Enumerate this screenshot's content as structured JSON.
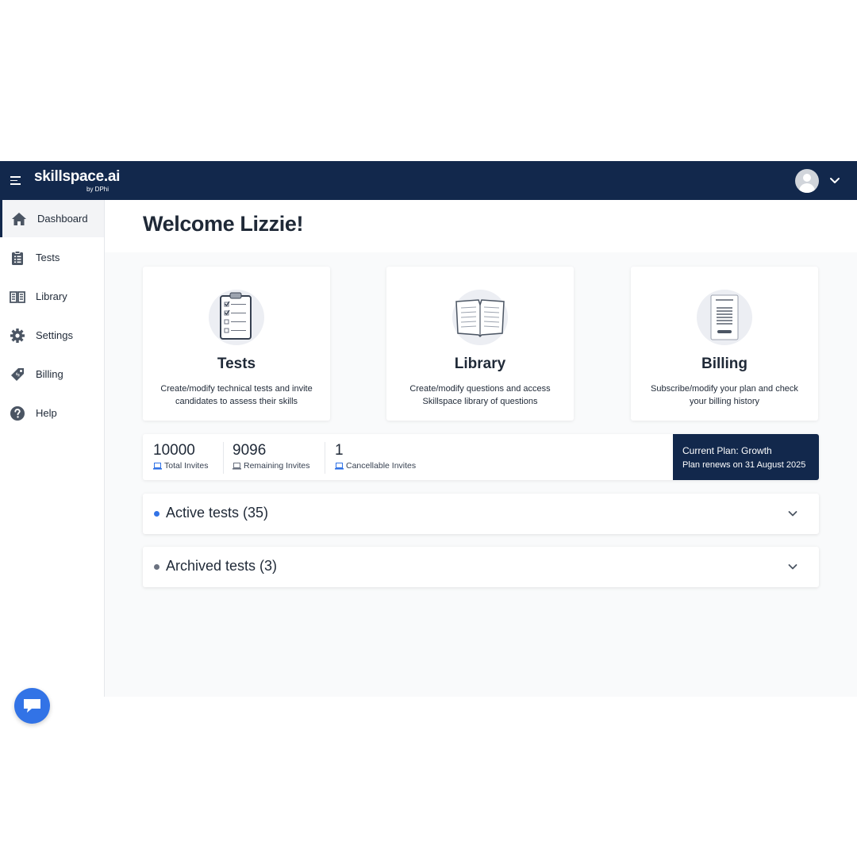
{
  "header": {
    "logo_main": "skillspace.ai",
    "logo_sub": "by DPhi",
    "menu_icon": "hamburger-icon",
    "avatar_icon": "user-avatar-icon",
    "chevron_icon": "chevron-down-icon"
  },
  "sidebar": {
    "items": [
      {
        "label": "Dashboard",
        "icon": "home-icon",
        "active": true
      },
      {
        "label": "Tests",
        "icon": "clipboard-icon"
      },
      {
        "label": "Library",
        "icon": "book-icon"
      },
      {
        "label": "Settings",
        "icon": "gear-icon"
      },
      {
        "label": "Billing",
        "icon": "price-tag-icon"
      },
      {
        "label": "Help",
        "icon": "help-circle-icon"
      }
    ],
    "chat_icon": "chat-bubble-icon"
  },
  "main": {
    "welcome": "Welcome Lizzie!",
    "cards": [
      {
        "title": "Tests",
        "description": "Create/modify technical tests and invite candidates to assess their skills",
        "icon": "clipboard-checklist-illustration"
      },
      {
        "title": "Library",
        "description": "Create/modify questions and access Skillspace library of questions",
        "icon": "open-book-illustration"
      },
      {
        "title": "Billing",
        "description": "Subscribe/modify your plan and check your billing history",
        "icon": "invoice-illustration"
      }
    ],
    "stats": [
      {
        "value": "10000",
        "label": "Total Invites",
        "icon": "laptop-icon"
      },
      {
        "value": "9096",
        "label": "Remaining Invites",
        "icon": "laptop-icon"
      },
      {
        "value": "1",
        "label": "Cancellable Invites",
        "icon": "laptop-icon"
      }
    ],
    "plan": {
      "title": "Current Plan: Growth",
      "renewal": "Plan renews on 31 August 2025"
    },
    "accordions": [
      {
        "title": "Active tests (35)",
        "dot_color": "#3273e6"
      },
      {
        "title": "Archived tests (3)",
        "dot_color": "#6b7280"
      }
    ]
  },
  "colors": {
    "navy": "#12284c",
    "accent_blue": "#3273e6",
    "background": "#f9fafb"
  }
}
